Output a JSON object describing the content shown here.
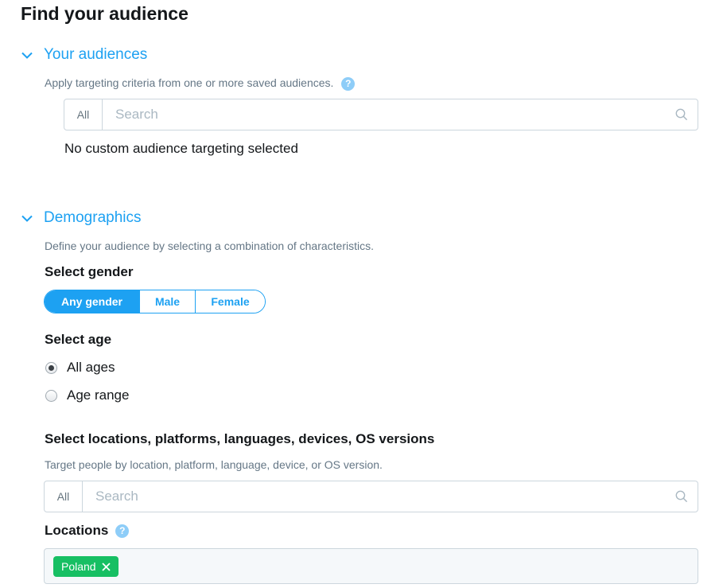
{
  "title": "Find your audience",
  "audiences": {
    "title": "Your audiences",
    "description": "Apply targeting criteria from one or more saved audiences.",
    "help": "?",
    "search": {
      "all_label": "All",
      "placeholder": "Search"
    },
    "empty_text": "No custom audience targeting selected"
  },
  "demographics": {
    "title": "Demographics",
    "description": "Define your audience by selecting a combination of characteristics.",
    "gender": {
      "label": "Select gender",
      "options": [
        "Any gender",
        "Male",
        "Female"
      ],
      "selected": "Any gender"
    },
    "age": {
      "label": "Select age",
      "options": [
        "All ages",
        "Age range"
      ],
      "selected": "All ages"
    },
    "targeting": {
      "label": "Select locations, platforms, languages, devices, OS versions",
      "description": "Target people by location, platform, language, device, or OS version.",
      "search": {
        "all_label": "All",
        "placeholder": "Search"
      }
    },
    "locations": {
      "label": "Locations",
      "help": "?",
      "selected": [
        "Poland"
      ]
    }
  },
  "colors": {
    "accent": "#1da1f2",
    "tag_green": "#17bf63",
    "help_blue": "#8ecdf8"
  }
}
